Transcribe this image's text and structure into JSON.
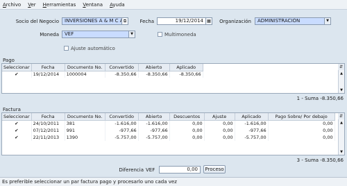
{
  "menu": [
    "Archivo",
    "Ver",
    "Herramientas",
    "Ventana",
    "Ayuda"
  ],
  "form": {
    "socio_label": "Socio del Negocio",
    "socio_value": "INVERSIONES A & M  C A",
    "fecha_label": "Fecha",
    "fecha_value": "19/12/2014",
    "org_label": "Organización",
    "org_value": "ADMINISTRACIÓN",
    "moneda_label": "Moneda",
    "moneda_value": "VEF",
    "multimoneda_label": "Multimoneda",
    "ajuste_label": "Ajuste automático"
  },
  "pago": {
    "title": "Pago",
    "columns": [
      "Seleccionar",
      "Fecha",
      "Documento No.",
      "Convertido",
      "Abierto",
      "Aplicado"
    ],
    "rows": [
      {
        "selected": true,
        "fecha": "19/12/2014",
        "doc": "1000004",
        "convertido": "-8.350,66",
        "abierto": "-8.350,66",
        "aplicado": "-8.350,66"
      }
    ],
    "summary": "1 - Suma  -8.350,66"
  },
  "factura": {
    "title": "Factura",
    "columns": [
      "Seleccionar",
      "Fecha",
      "Documento No.",
      "Convertido",
      "Abierto",
      "Descuentos",
      "Ajuste",
      "Aplicado",
      "Pago Sobre/ Por debajo"
    ],
    "rows": [
      {
        "selected": true,
        "fecha": "24/10/2011",
        "doc": "381",
        "convertido": "-1.616,00",
        "abierto": "-1.616,00",
        "descuentos": "0,00",
        "ajuste": "0,00",
        "aplicado": "-1.616,00",
        "sobre": "0,00"
      },
      {
        "selected": true,
        "fecha": "07/12/2011",
        "doc": "991",
        "convertido": "-977,66",
        "abierto": "-977,66",
        "descuentos": "0,00",
        "ajuste": "0,00",
        "aplicado": "-977,66",
        "sobre": "0,00"
      },
      {
        "selected": true,
        "fecha": "22/11/2013",
        "doc": "1390",
        "convertido": "-5.757,00",
        "abierto": "-5.757,00",
        "descuentos": "0,00",
        "ajuste": "0,00",
        "aplicado": "-5.757,00",
        "sobre": "0,00"
      }
    ],
    "summary": "3 - Suma  -8.350,66"
  },
  "footer": {
    "diferencia_label": "Diferencia",
    "diferencia_currency": "VEF",
    "diferencia_value": "0,00",
    "proceso_label": "Proceso"
  },
  "status": "Es preferible seleccionar un par factura pago y procesarlo uno cada vez",
  "colors": {
    "selected_field": "#c9dcff",
    "background": "#dce6ef"
  }
}
